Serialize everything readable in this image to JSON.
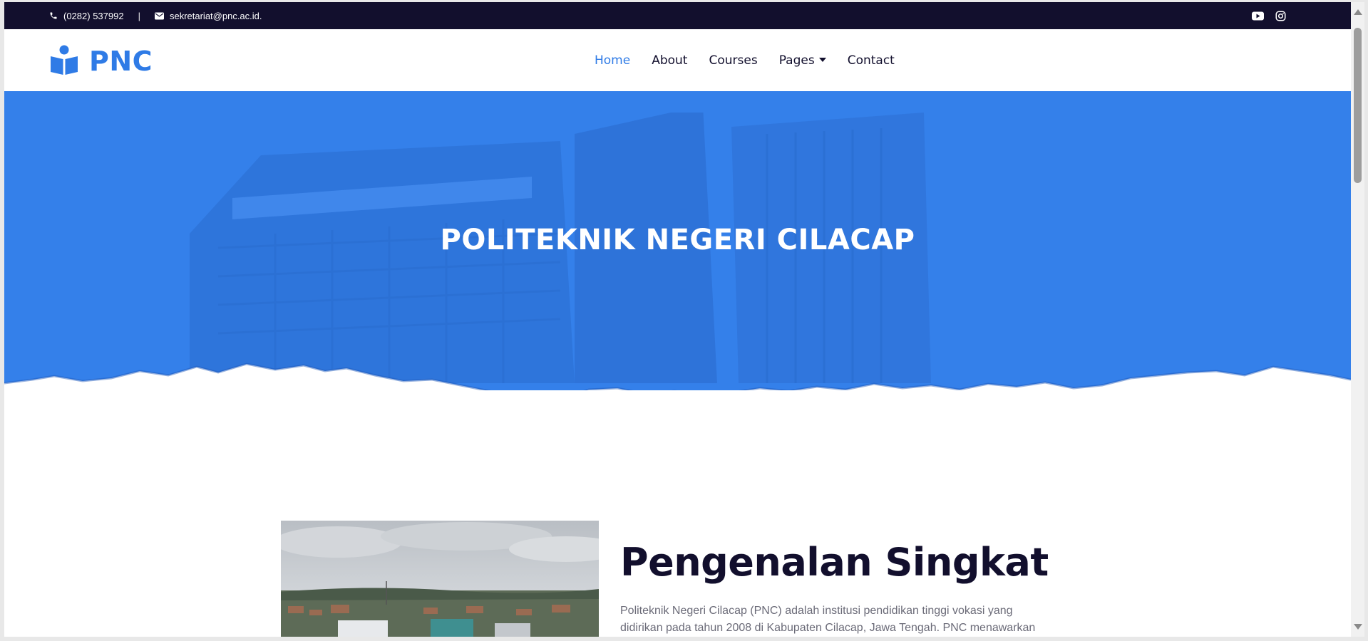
{
  "topbar": {
    "phone": "(0282) 537992",
    "separator": "|",
    "email": "sekretariat@pnc.ac.id.",
    "social": [
      "youtube-icon",
      "instagram-icon"
    ]
  },
  "brand": {
    "name": "PNC"
  },
  "nav": {
    "items": [
      {
        "label": "Home",
        "active": true
      },
      {
        "label": "About"
      },
      {
        "label": "Courses"
      },
      {
        "label": "Pages",
        "dropdown": true
      },
      {
        "label": "Contact"
      }
    ]
  },
  "hero": {
    "title": "POLITEKNIK NEGERI CILACAP"
  },
  "intro": {
    "title": "Pengenalan Singkat",
    "text_line1": "Politeknik Negeri Cilacap (PNC) adalah institusi pendidikan tinggi vokasi yang",
    "text_line2": "didirikan pada tahun 2008 di Kabupaten Cilacap, Jawa Tengah. PNC menawarkan"
  },
  "colors": {
    "topbar": "#120f2d",
    "accent": "#2f7be6",
    "hero": "#3480ea",
    "heading": "#120f2d"
  }
}
